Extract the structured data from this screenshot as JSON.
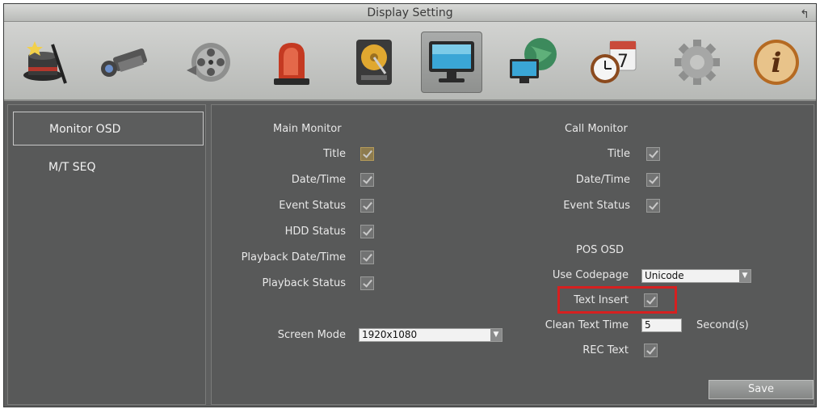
{
  "window": {
    "title": "Display Setting"
  },
  "toolbar": {
    "icons": [
      "wizard-hat-icon",
      "camera-icon",
      "film-reel-icon",
      "alarm-light-icon",
      "hard-drive-icon",
      "monitor-icon",
      "network-globe-icon",
      "clock-calendar-icon",
      "gear-icon",
      "info-icon"
    ],
    "active": "monitor-icon",
    "calendar_day": "7",
    "info_glyph": "i"
  },
  "sidebar": {
    "items": [
      {
        "label": "Monitor OSD",
        "selected": true
      },
      {
        "label": "M/T SEQ",
        "selected": false
      }
    ]
  },
  "main_monitor": {
    "heading": "Main Monitor",
    "options": [
      {
        "label": "Title",
        "checked": true
      },
      {
        "label": "Date/Time",
        "checked": true
      },
      {
        "label": "Event Status",
        "checked": true
      },
      {
        "label": "HDD Status",
        "checked": true
      },
      {
        "label": "Playback Date/Time",
        "checked": true
      },
      {
        "label": "Playback Status",
        "checked": true
      }
    ],
    "screen_mode_label": "Screen Mode",
    "screen_mode_value": "1920x1080"
  },
  "call_monitor": {
    "heading": "Call Monitor",
    "options": [
      {
        "label": "Title",
        "checked": true
      },
      {
        "label": "Date/Time",
        "checked": true
      },
      {
        "label": "Event Status",
        "checked": true
      }
    ]
  },
  "pos_osd": {
    "heading": "POS OSD",
    "codepage_label": "Use Codepage",
    "codepage_value": "Unicode",
    "text_insert_label": "Text Insert",
    "text_insert_checked": true,
    "clean_text_time_label": "Clean Text Time",
    "clean_text_time_value": "5",
    "clean_text_time_unit": "Second(s)",
    "rec_text_label": "REC Text",
    "rec_text_checked": true
  },
  "actions": {
    "save_label": "Save"
  },
  "colors": {
    "highlight": "#d62020",
    "panel": "#585959",
    "titlebar": "#c9cac8"
  }
}
